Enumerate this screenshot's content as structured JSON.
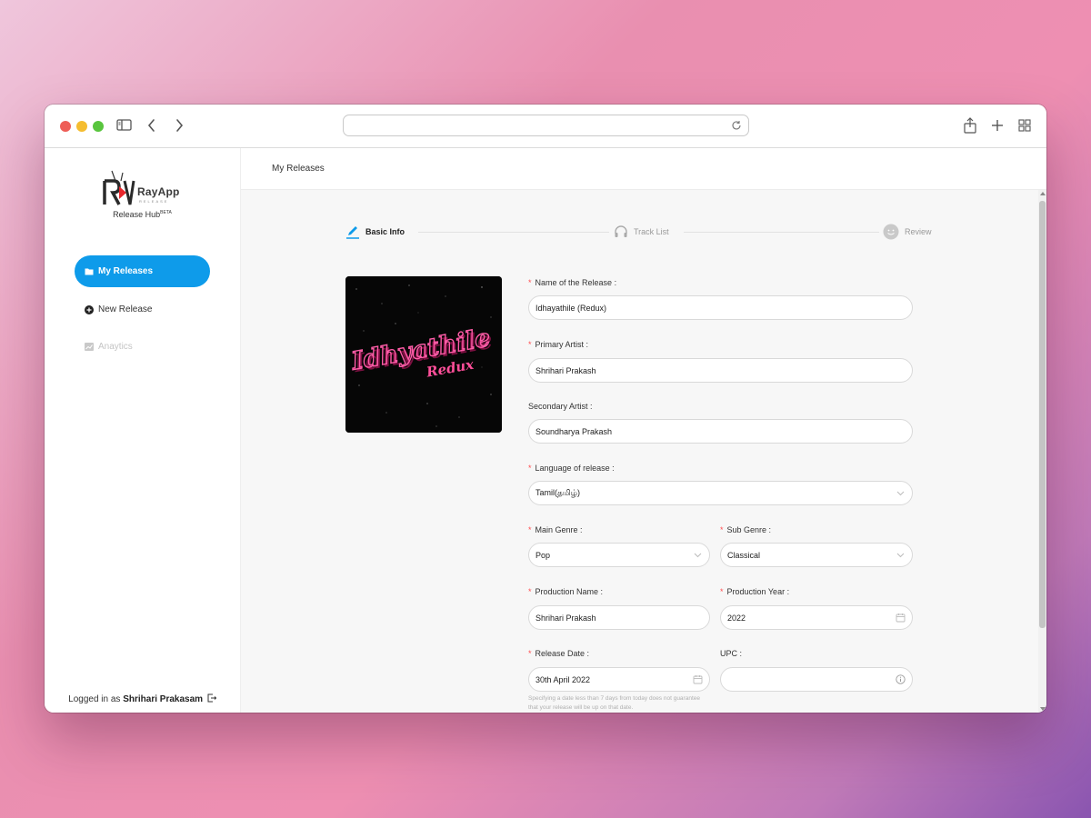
{
  "browser": {
    "address_value": ""
  },
  "sidebar": {
    "logo_word": "RayApp",
    "logo_sub": "RELEASE",
    "hub_title": "Release Hub",
    "hub_badge": "BETA",
    "items": [
      {
        "label": "My Releases",
        "icon": "folder-icon",
        "state": "active"
      },
      {
        "label": "New Release",
        "icon": "plus-circle-icon",
        "state": "normal"
      },
      {
        "label": "Anaytics",
        "icon": "chart-icon",
        "state": "disabled"
      }
    ],
    "logged_prefix": "Logged in as",
    "logged_user": "Shrihari Prakasam"
  },
  "header": {
    "breadcrumb": "My Releases"
  },
  "steps": [
    {
      "label": "Basic Info",
      "icon": "pencil-icon",
      "active": true
    },
    {
      "label": "Track List",
      "icon": "headphones-icon",
      "active": false
    },
    {
      "label": "Review",
      "icon": "smile-icon",
      "active": false
    }
  ],
  "cover": {
    "title_line1": "Idhyathile",
    "title_line2": "Redux"
  },
  "form": {
    "release_name": {
      "label": "Name of the Release :",
      "required": true,
      "value": "Idhayathile (Redux)"
    },
    "primary_artist": {
      "label": "Primary Artist :",
      "required": true,
      "value": "Shrihari Prakash"
    },
    "secondary_artist": {
      "label": "Secondary Artist :",
      "required": false,
      "value": "Soundharya Prakash"
    },
    "language": {
      "label": "Language of release :",
      "required": true,
      "value": "Tamil(தமிழ்)"
    },
    "main_genre": {
      "label": "Main Genre :",
      "required": true,
      "value": "Pop"
    },
    "sub_genre": {
      "label": "Sub Genre :",
      "required": true,
      "value": "Classical"
    },
    "production_name": {
      "label": "Production Name :",
      "required": true,
      "value": "Shrihari Prakash"
    },
    "production_year": {
      "label": "Production Year :",
      "required": true,
      "value": "2022"
    },
    "release_date": {
      "label": "Release Date :",
      "required": true,
      "value": "30th April 2022",
      "hint": "Specifying a date less than 7 days from today does not guarantee that your release will be up on that date."
    },
    "upc": {
      "label": "UPC :",
      "required": false,
      "value": ""
    }
  },
  "colors": {
    "accent": "#0e9bea",
    "required": "#ff4d4f",
    "cover_text": "#ff4f9a"
  }
}
